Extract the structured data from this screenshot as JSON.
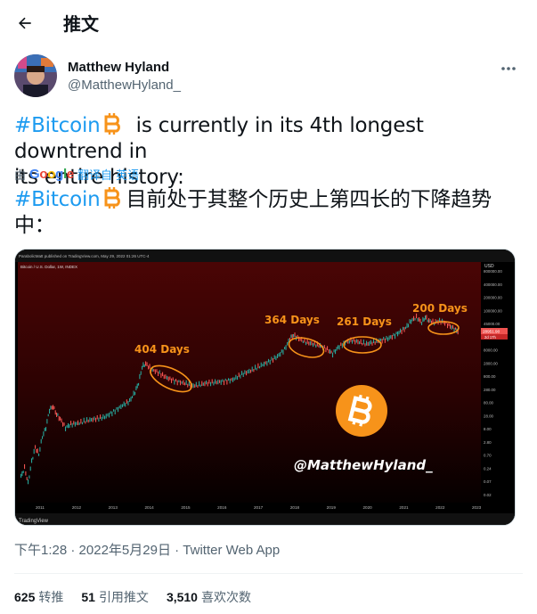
{
  "header": {
    "title": "推文"
  },
  "author": {
    "display_name": "Matthew Hyland",
    "handle": "@MatthewHyland_"
  },
  "tweet": {
    "hashtag": "#Bitcoin",
    "text_en_rest": "is currently in its 4th longest downtrend in",
    "text_en_rest2": "its entire history:",
    "translated_by_prefix": "由",
    "translator": "Google",
    "translated_from": "翻译自 英语",
    "text_zh_rest": "目前处于其整个历史上第四长的下降趋势",
    "text_zh_rest2": "中："
  },
  "media": {
    "header_text": "ParabolicMatt published on TradingView.com, May 29, 2022 01:26 UTC-4",
    "symbol_text": "Bitcoin / U.S. Dollar, 1W, INDEX",
    "currency": "USD",
    "watermark": "@MatthewHyland_",
    "tv_logo": "TradingView",
    "annotations": [
      "404 Days",
      "364 Days",
      "261 Days",
      "200 Days"
    ],
    "price_label": "28951.90",
    "price_sublabel": "2d 17h",
    "x_ticks": [
      "2011",
      "2012",
      "2013",
      "2014",
      "2015",
      "2016",
      "2017",
      "2018",
      "2019",
      "2020",
      "2021",
      "2022",
      "2023"
    ],
    "y_ticks": [
      "800000.00",
      "400000.00",
      "200000.00",
      "100000.00",
      "45000.00",
      "20000.00",
      "8000.00",
      "2800.00",
      "800.00",
      "280.00",
      "80.00",
      "28.00",
      "8.00",
      "2.80",
      "0.70",
      "0.24",
      "0.07",
      "0.02"
    ],
    "colors": {
      "bg_top": "#3a0000",
      "bg_bottom": "#000000",
      "candle_up": "#26a69a",
      "candle_down": "#ef5350",
      "ellipse": "#f7931a",
      "label": "#f7931a"
    }
  },
  "meta": {
    "time": "下午1:28",
    "date": "2022年5月29日",
    "sep": "·",
    "app": "Twitter Web App"
  },
  "stats": [
    {
      "count": "625",
      "label": "转推"
    },
    {
      "count": "51",
      "label": "引用推文"
    },
    {
      "count": "3,510",
      "label": "喜欢次数"
    }
  ]
}
